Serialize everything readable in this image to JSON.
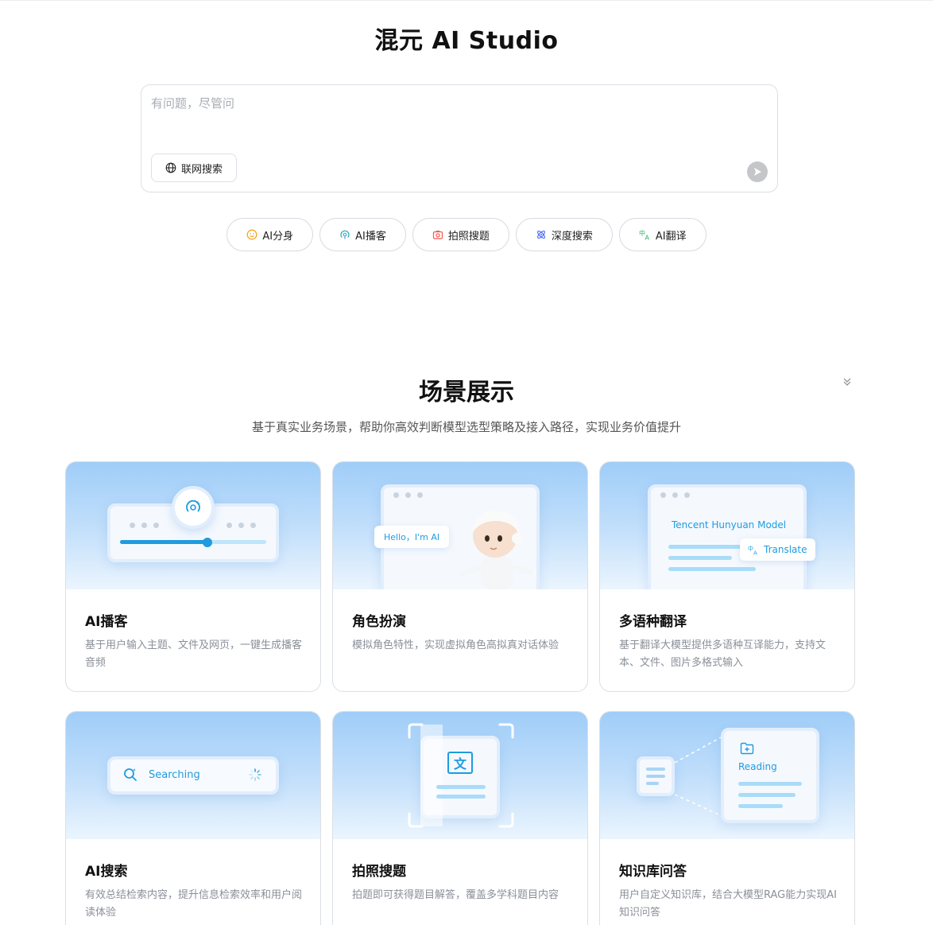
{
  "header": {
    "title": "混元 AI Studio"
  },
  "chat": {
    "placeholder": "有问题，尽管问",
    "web_search_label": "联网搜索"
  },
  "quick_actions": [
    {
      "label": "AI分身",
      "icon": "smile-icon",
      "color": "#f5a623"
    },
    {
      "label": "AI播客",
      "icon": "podcast-icon",
      "color": "#2bb3a3"
    },
    {
      "label": "拍照搜题",
      "icon": "camera-icon",
      "color": "#f2584f"
    },
    {
      "label": "深度搜索",
      "icon": "atom-icon",
      "color": "#4a6cf7"
    },
    {
      "label": "AI翻译",
      "icon": "translate-icon",
      "color": "#2fb36b"
    }
  ],
  "scenes": {
    "title": "场景展示",
    "subtitle": "基于真实业务场景，帮助你高效判断模型选型策略及接入路径，实现业务价值提升",
    "cards": [
      {
        "title": "AI播客",
        "desc": "基于用户输入主题、文件及网页，一键生成播客音频",
        "art_progress": 0.6
      },
      {
        "title": "角色扮演",
        "desc": "模拟角色特性，实现虚拟角色高拟真对话体验",
        "art_text": "Hello，I'm AI"
      },
      {
        "title": "多语种翻译",
        "desc": "基于翻译大模型提供多语种互译能力，支持文本、文件、图片多格式输入",
        "art_text": "Tencent Hunyuan Model",
        "art_text2": "Translate"
      },
      {
        "title": "AI搜索",
        "desc": "有效总结检索内容，提升信息检索效率和用户阅读体验",
        "art_text": "Searching"
      },
      {
        "title": "拍照搜题",
        "desc": "拍题即可获得题目解答，覆盖多学科题目内容",
        "art_text": "文"
      },
      {
        "title": "知识库问答",
        "desc": "用户自定义知识库，结合大模型RAG能力实现AI知识问答",
        "art_text": "Reading"
      }
    ]
  },
  "colors": {
    "accent": "#1f9be0",
    "border": "#dcdfe6"
  }
}
